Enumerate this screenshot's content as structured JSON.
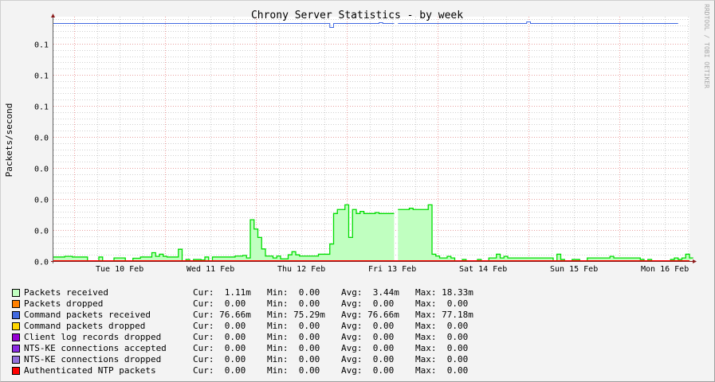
{
  "title": "Chrony Server Statistics - by week",
  "watermark": "RRDTOOL / TOBI OETIKER",
  "chart_data": {
    "type": "area",
    "title": "Chrony Server Statistics - by week",
    "ylabel": "Packets/second",
    "xlabel": "",
    "ylim": [
      0,
      0.079
    ],
    "y_ticks": [
      0,
      0.01,
      0.02,
      0.03,
      0.04,
      0.05,
      0.06,
      0.07
    ],
    "y_tick_labels": [
      "0.0",
      "0.0",
      "0.0",
      "0.0",
      "0.0",
      "0.1",
      "0.1",
      "0.1"
    ],
    "x_range": [
      "Feb 09 18:30",
      "Feb 16 18:30"
    ],
    "x_tick_labels": [
      {
        "label": "Tue 10 Feb",
        "date": "Feb 10"
      },
      {
        "label": "Wed 11 Feb",
        "date": "Feb 11"
      },
      {
        "label": "Thu 12 Feb",
        "date": "Feb 12"
      },
      {
        "label": "Fri 13 Feb",
        "date": "Feb 13"
      },
      {
        "label": "Sat 14 Feb",
        "date": "Feb 14"
      },
      {
        "label": "Sun 15 Feb",
        "date": "Feb 15"
      },
      {
        "label": "Mon 16 Feb",
        "date": "Feb 16"
      }
    ],
    "grid": true,
    "sample_interval": "1 hour",
    "value_unit": "m (milli packets/second)",
    "series": [
      {
        "name": "Packets received",
        "color": "#c0ffc0",
        "line_color": "#00dd00",
        "style": "area",
        "values": [
          1.3,
          1.3,
          1.3,
          1.5,
          1.5,
          1.3,
          1.3,
          1.3,
          1.3,
          0,
          0,
          0,
          1.3,
          0,
          0,
          0,
          1.0,
          1.0,
          1.0,
          0,
          0,
          0.9,
          0.9,
          1.3,
          1.3,
          1.3,
          2.7,
          1.5,
          2.2,
          1.5,
          1.3,
          1.3,
          1.3,
          3.8,
          0,
          0.5,
          0,
          0.5,
          0.5,
          0.3,
          1.3,
          0,
          1.3,
          1.3,
          1.3,
          1.3,
          1.3,
          1.3,
          1.6,
          1.6,
          1.8,
          1.0,
          13.3,
          10.3,
          7.6,
          3.9,
          1.6,
          1.6,
          1.0,
          1.6,
          0.7,
          0.7,
          2.0,
          3.0,
          2.0,
          1.6,
          1.6,
          1.6,
          1.6,
          1.6,
          2.2,
          2.2,
          2.2,
          5.5,
          15.3,
          16.6,
          16.6,
          18.1,
          7.6,
          16.6,
          15.3,
          16.0,
          15.3,
          15.3,
          15.3,
          15.6,
          15.3,
          15.3,
          15.3,
          15.3,
          null,
          16.6,
          16.6,
          16.6,
          17.0,
          16.6,
          16.6,
          16.6,
          16.6,
          18.1,
          2.2,
          1.6,
          1.0,
          1.0,
          1.5,
          1.0,
          0,
          0,
          0.5,
          0,
          0,
          0,
          0.5,
          0,
          0,
          1.0,
          1.0,
          2.2,
          1.0,
          1.5,
          1.0,
          1.0,
          1.0,
          1.0,
          1.0,
          1.0,
          1.0,
          1.0,
          1.0,
          1.0,
          1.0,
          1.0,
          0,
          2.2,
          0.5,
          0,
          0,
          0.5,
          0.5,
          0,
          0,
          1.0,
          1.0,
          1.0,
          1.0,
          1.0,
          1.0,
          1.5,
          1.0,
          1.0,
          1.0,
          1.0,
          1.0,
          1.0,
          1.0,
          0.5,
          0,
          0.5,
          0,
          0,
          0,
          0,
          0,
          0.5,
          1.0,
          0.5,
          1.0,
          2.2,
          1.0
        ]
      },
      {
        "name": "Command packets received",
        "color": "#4169e1",
        "style": "line",
        "values": [
          76.66,
          76.66,
          76.66,
          76.66,
          76.66,
          76.66,
          76.66,
          76.66,
          76.66,
          76.66,
          76.66,
          76.66,
          76.66,
          76.66,
          76.66,
          76.66,
          76.66,
          76.66,
          76.66,
          76.66,
          76.66,
          76.66,
          76.66,
          76.66,
          76.66,
          76.66,
          76.66,
          76.66,
          76.66,
          76.66,
          76.66,
          76.66,
          76.66,
          76.66,
          76.66,
          76.66,
          76.66,
          76.66,
          76.66,
          76.66,
          76.66,
          76.66,
          76.66,
          76.66,
          76.66,
          76.66,
          76.66,
          76.66,
          76.66,
          76.66,
          76.66,
          76.66,
          76.66,
          76.66,
          76.66,
          76.66,
          76.66,
          76.66,
          76.66,
          76.66,
          76.66,
          76.66,
          76.66,
          76.66,
          76.66,
          76.66,
          76.66,
          76.66,
          76.66,
          76.66,
          76.66,
          76.66,
          76.66,
          75.29,
          76.66,
          76.66,
          76.66,
          76.66,
          76.66,
          76.66,
          76.66,
          76.66,
          76.66,
          76.66,
          76.66,
          76.66,
          76.9,
          76.66,
          76.66,
          76.66,
          null,
          76.66,
          76.66,
          76.66,
          76.66,
          76.66,
          76.66,
          76.66,
          76.66,
          76.66,
          76.66,
          76.66,
          76.66,
          76.66,
          76.66,
          76.66,
          76.66,
          76.66,
          76.66,
          76.66,
          76.66,
          76.66,
          76.66,
          76.66,
          76.66,
          76.66,
          76.66,
          76.66,
          76.66,
          76.66,
          76.66,
          76.66,
          76.66,
          76.66,
          76.66,
          77.18,
          76.66,
          76.66,
          76.66,
          76.66,
          76.66,
          76.66,
          76.66,
          76.66,
          76.66,
          76.66,
          76.66,
          76.66,
          76.66,
          76.66,
          76.66,
          76.66,
          76.66,
          76.66,
          76.66,
          76.66,
          76.66,
          76.66,
          76.66,
          76.66,
          76.66,
          76.66,
          76.66,
          76.66,
          76.66,
          76.66,
          76.66,
          76.66,
          76.66,
          76.66,
          76.66,
          76.66,
          76.66,
          76.66,
          76.66
        ]
      }
    ]
  },
  "legend": [
    {
      "label": "Packets received",
      "color": "#c0ffc0",
      "cur": "1.11m",
      "min": "0.00",
      "avg": "3.44m",
      "max": "18.33m"
    },
    {
      "label": "Packets dropped",
      "color": "#ff8000",
      "cur": "0.00",
      "min": "0.00",
      "avg": "0.00",
      "max": "0.00"
    },
    {
      "label": "Command packets received",
      "color": "#4169e1",
      "cur": "76.66m",
      "min": "75.29m",
      "avg": "76.66m",
      "max": "77.18m"
    },
    {
      "label": "Command packets dropped",
      "color": "#ffd700",
      "cur": "0.00",
      "min": "0.00",
      "avg": "0.00",
      "max": "0.00"
    },
    {
      "label": "Client log records dropped",
      "color": "#9400d3",
      "cur": "0.00",
      "min": "0.00",
      "avg": "0.00",
      "max": "0.00"
    },
    {
      "label": "NTS-KE connections accepted",
      "color": "#8a2be2",
      "cur": "0.00",
      "min": "0.00",
      "avg": "0.00",
      "max": "0.00"
    },
    {
      "label": "NTS-KE connections dropped",
      "color": "#9370db",
      "cur": "0.00",
      "min": "0.00",
      "avg": "0.00",
      "max": "0.00"
    },
    {
      "label": "Authenticated NTP packets",
      "color": "#ff0000",
      "cur": "0.00",
      "min": "0.00",
      "avg": "0.00",
      "max": "0.00"
    }
  ],
  "stat_labels": {
    "cur": "Cur:",
    "min": "Min:",
    "avg": "Avg:",
    "max": "Max:"
  }
}
